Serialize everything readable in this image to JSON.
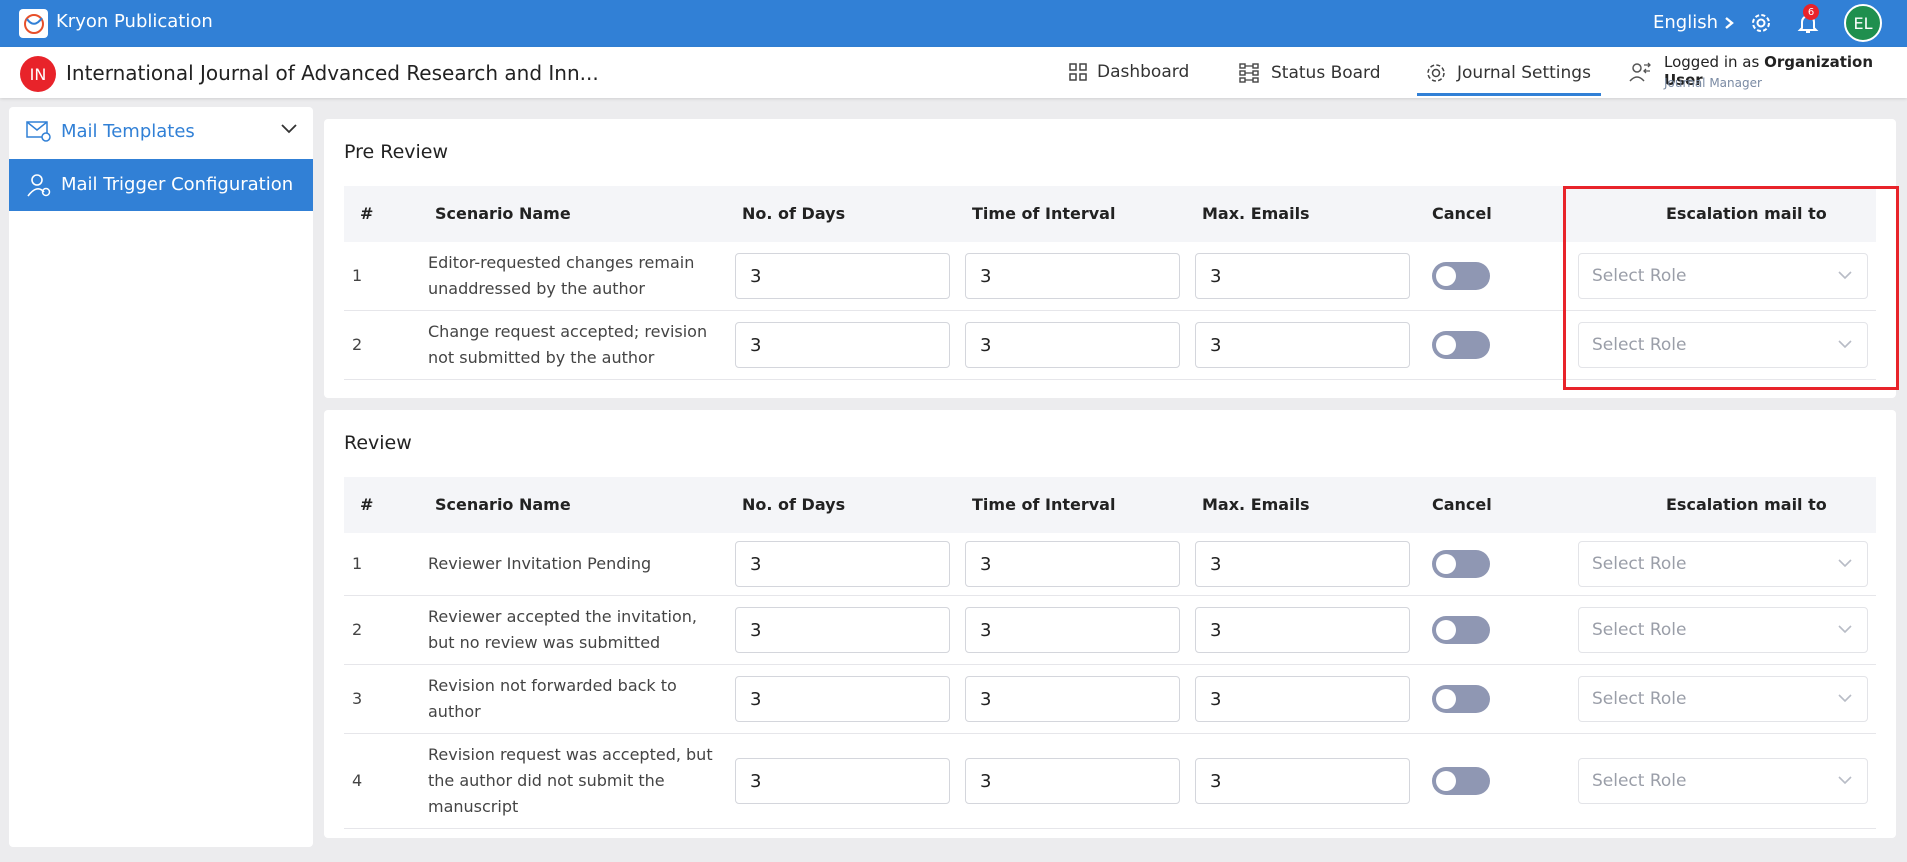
{
  "topbar": {
    "app_title": "Kryon Publication",
    "language": "English",
    "notification_count": "6",
    "avatar_initials": "EL",
    "brand_color": "#3180d6"
  },
  "subheader": {
    "journal_initials": "IN",
    "journal_title": "International Journal of Advanced Research and Inn...",
    "nav": [
      {
        "label": "Dashboard",
        "icon": "grid-icon"
      },
      {
        "label": "Status Board",
        "icon": "status-board-icon"
      },
      {
        "label": "Journal Settings",
        "icon": "gear-icon",
        "active": true
      }
    ],
    "logged_prefix": "Logged in as",
    "logged_user": "Organization User",
    "logged_role": "Journal Manager"
  },
  "sidebar": {
    "items": [
      {
        "label": "Mail Templates",
        "icon": "mail-settings-icon",
        "active": false
      },
      {
        "label": "Mail Trigger Configuration",
        "icon": "user-settings-icon",
        "active": true
      }
    ]
  },
  "columns": {
    "num": "#",
    "scenario": "Scenario Name",
    "days": "No. of Days",
    "interval": "Time of Interval",
    "max": "Max. Emails",
    "cancel": "Cancel",
    "escalation": "Escalation mail to"
  },
  "pre_review": {
    "title": "Pre Review",
    "rows": [
      {
        "num": "1",
        "name": "Editor-requested changes remain unaddressed by the author",
        "days": "3",
        "interval": "3",
        "max": "3",
        "cancel": false,
        "role_placeholder": "Select Role"
      },
      {
        "num": "2",
        "name": "Change request accepted; revision not submitted by the author",
        "days": "3",
        "interval": "3",
        "max": "3",
        "cancel": false,
        "role_placeholder": "Select Role"
      }
    ]
  },
  "review": {
    "title": "Review",
    "rows": [
      {
        "num": "1",
        "name": "Reviewer Invitation Pending",
        "days": "3",
        "interval": "3",
        "max": "3",
        "cancel": false,
        "role_placeholder": "Select Role"
      },
      {
        "num": "2",
        "name": "Reviewer accepted the invitation, but no review was submitted",
        "days": "3",
        "interval": "3",
        "max": "3",
        "cancel": false,
        "role_placeholder": "Select Role"
      },
      {
        "num": "3",
        "name": "Revision not forwarded back to author",
        "days": "3",
        "interval": "3",
        "max": "3",
        "cancel": false,
        "role_placeholder": "Select Role"
      },
      {
        "num": "4",
        "name": "Revision request was accepted, but the author did not submit the manuscript",
        "days": "3",
        "interval": "3",
        "max": "3",
        "cancel": false,
        "role_placeholder": "Select Role"
      }
    ]
  }
}
